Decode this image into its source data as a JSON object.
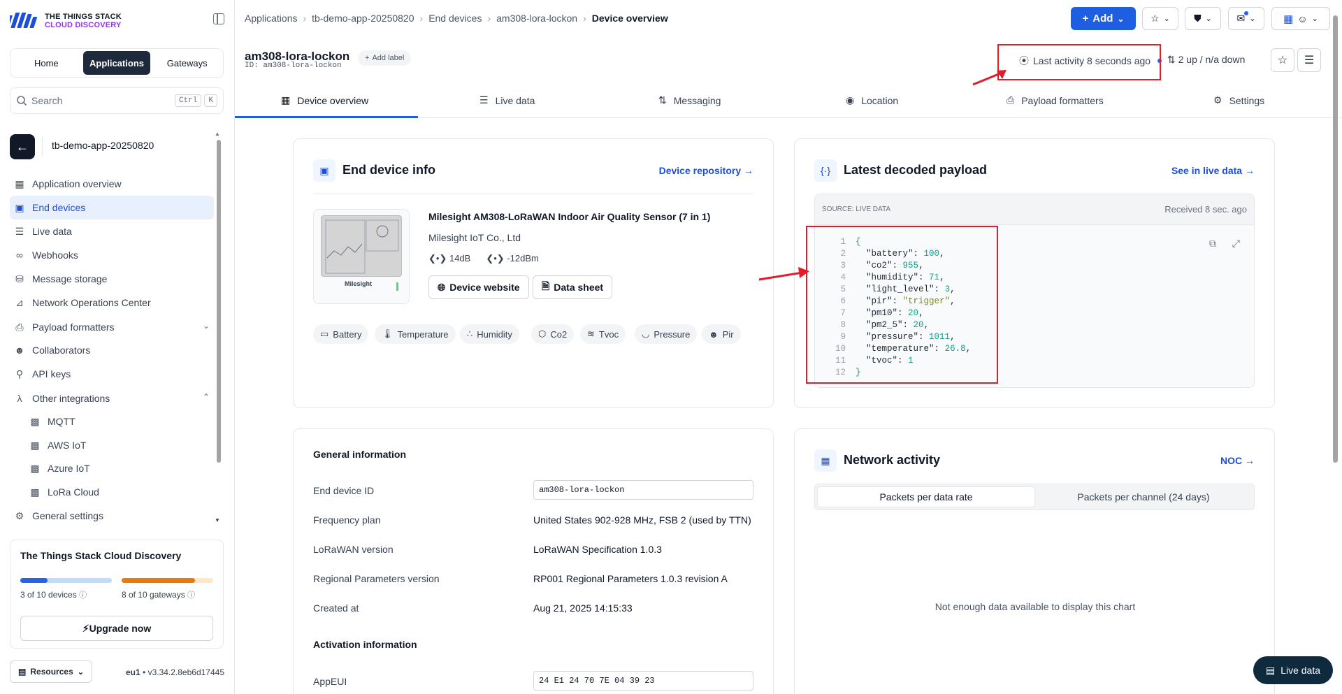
{
  "brand": {
    "line1": "THE THINGS STACK",
    "line2": "CLOUD DISCOVERY"
  },
  "sidebar": {
    "tabs": [
      "Home",
      "Applications",
      "Gateways"
    ],
    "search_placeholder": "Search",
    "kbd1": "Ctrl",
    "kbd2": "K",
    "app_name": "tb-demo-app-20250820",
    "items": [
      {
        "label": "Application overview",
        "icon": "grid-icon"
      },
      {
        "label": "End devices",
        "icon": "chip-icon"
      },
      {
        "label": "Live data",
        "icon": "list-icon"
      },
      {
        "label": "Webhooks",
        "icon": "webhook-icon"
      },
      {
        "label": "Message storage",
        "icon": "database-icon"
      },
      {
        "label": "Network Operations Center",
        "icon": "chart-icon"
      },
      {
        "label": "Payload formatters",
        "icon": "code-file-icon"
      },
      {
        "label": "Collaborators",
        "icon": "users-icon"
      },
      {
        "label": "API keys",
        "icon": "key-icon"
      },
      {
        "label": "Other integrations",
        "icon": "integration-icon"
      },
      {
        "label": "MQTT",
        "icon": "puzzle-icon"
      },
      {
        "label": "AWS IoT",
        "icon": "puzzle-icon"
      },
      {
        "label": "Azure IoT",
        "icon": "puzzle-icon"
      },
      {
        "label": "LoRa Cloud",
        "icon": "puzzle-icon"
      },
      {
        "label": "General settings",
        "icon": "gear-icon"
      }
    ],
    "plan": {
      "title": "The Things Stack Cloud Discovery",
      "devices_label": "3 of 10 devices",
      "gateways_label": "8 of 10 gateways",
      "devices_fraction": 0.3,
      "gateways_fraction": 0.8,
      "upgrade": "Upgrade now"
    },
    "resources": "Resources",
    "version_region": "eu1",
    "version": "v3.34.2.8eb6d17445"
  },
  "breadcrumbs": [
    "Applications",
    "tb-demo-app-20250820",
    "End devices",
    "am308-lora-lockon",
    "Device overview"
  ],
  "topbar": {
    "add": "Add"
  },
  "device": {
    "name": "am308-lora-lockon",
    "id_line": "ID: am308-lora-lockon",
    "add_label": "Add label",
    "last_activity": "Last activity 8 seconds ago",
    "updown": "2 up / n/a down"
  },
  "tabs": [
    "Device overview",
    "Live data",
    "Messaging",
    "Location",
    "Payload formatters",
    "Settings"
  ],
  "end_device_info": {
    "title": "End device info",
    "link": "Device repository →",
    "model": "Milesight AM308-LoRaWAN Indoor Air Quality Sensor (7 in 1)",
    "vendor": "Milesight IoT Co., Ltd",
    "rssi": "14dB",
    "power": "-12dBm",
    "website_btn": "Device website",
    "datasheet_btn": "Data sheet",
    "chips": [
      "Battery",
      "Temperature",
      "Humidity",
      "Co2",
      "Tvoc",
      "Pressure",
      "Pir"
    ]
  },
  "payload": {
    "title": "Latest decoded payload",
    "link": "See in live data →",
    "source": "SOURCE: LIVE DATA",
    "received": "Received 8 sec. ago",
    "lines": [
      "{",
      "  \"battery\": 100,",
      "  \"co2\": 955,",
      "  \"humidity\": 71,",
      "  \"light_level\": 3,",
      "  \"pir\": \"trigger\",",
      "  \"pm10\": 20,",
      "  \"pm2_5\": 20,",
      "  \"pressure\": 1011,",
      "  \"temperature\": 26.8,",
      "  \"tvoc\": 1",
      "}"
    ]
  },
  "general": {
    "heading": "General information",
    "rows": [
      {
        "label": "End device ID",
        "value": "am308-lora-lockon",
        "field": true
      },
      {
        "label": "Frequency plan",
        "value": "United States 902-928 MHz, FSB 2 (used by TTN)"
      },
      {
        "label": "LoRaWAN version",
        "value": "LoRaWAN Specification 1.0.3"
      },
      {
        "label": "Regional Parameters version",
        "value": "RP001 Regional Parameters 1.0.3 revision A"
      },
      {
        "label": "Created at",
        "value": "Aug 21, 2025 14:15:33"
      }
    ],
    "activation_heading": "Activation information",
    "appeui_label": "AppEUI",
    "appeui": "24 E1 24 70 7E 04 39 23"
  },
  "network": {
    "title": "Network activity",
    "link": "NOC →",
    "tab1": "Packets per data rate",
    "tab2": "Packets per channel (24 days)",
    "empty": "Not enough data available to display this chart"
  },
  "live_btn": "Live data",
  "colors": {
    "primary": "#1d5fe0",
    "annotation": "#e11d2a",
    "progress_devices": "#2563eb",
    "progress_gateways": "#ea7a0c"
  }
}
